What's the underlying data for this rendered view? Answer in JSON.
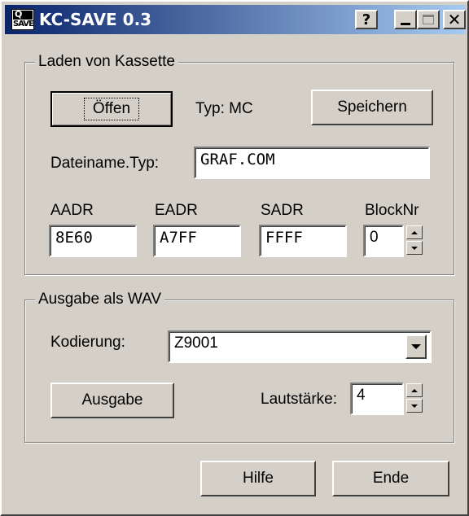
{
  "window": {
    "title": "KC-SAVE 0.3",
    "icon": {
      "top_text": "Q",
      "bottom_text": "SAVE"
    },
    "help_label": "?",
    "close_label": "✕"
  },
  "load_group": {
    "label": "Laden von Kassette",
    "open_label": "Öffen",
    "type_label": "Typ: MC",
    "save_label": "Speichern",
    "filename_label": "Dateiname.Typ:",
    "filename_value": "GRAF.COM",
    "aadr_label": "AADR",
    "aadr_value": "8E60",
    "eadr_label": "EADR",
    "eadr_value": "A7FF",
    "sadr_label": "SADR",
    "sadr_value": "FFFF",
    "blocknr_label": "BlockNr",
    "blocknr_value": "0"
  },
  "wav_group": {
    "label": "Ausgabe als WAV",
    "encoding_label": "Kodierung:",
    "encoding_value": "Z9001",
    "output_label": "Ausgabe",
    "volume_label": "Lautstärke:",
    "volume_value": "4"
  },
  "footer": {
    "help_label": "Hilfe",
    "end_label": "Ende"
  }
}
